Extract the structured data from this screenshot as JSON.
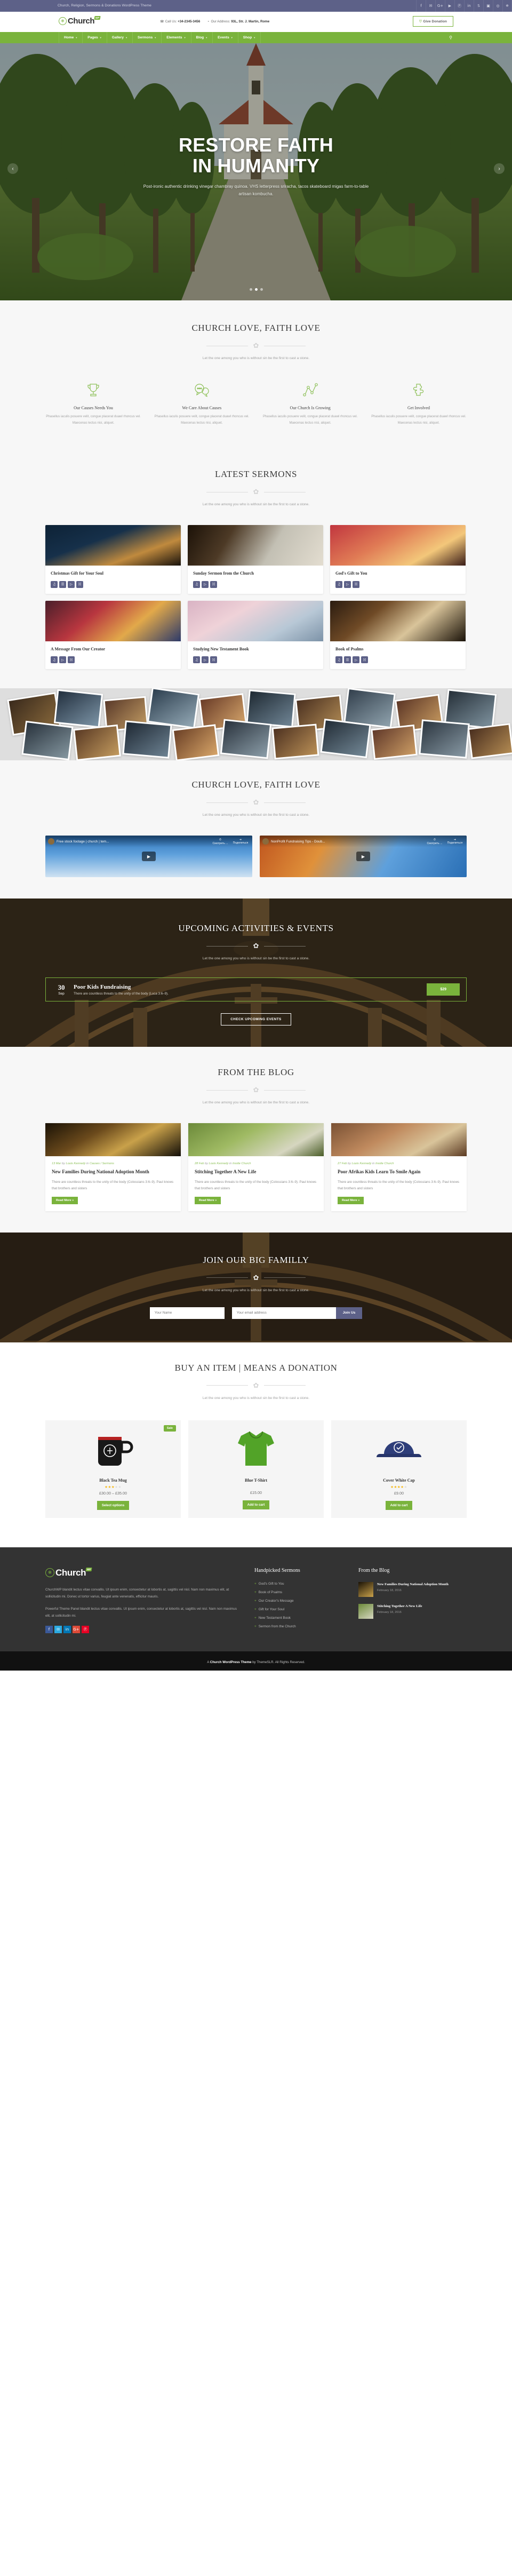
{
  "topbar": {
    "tagline": "Church, Religion, Sermons & Donations WordPress Theme",
    "social": [
      {
        "name": "facebook-icon",
        "glyph": "f"
      },
      {
        "name": "twitter-icon",
        "glyph": "✉"
      },
      {
        "name": "google-plus-icon",
        "glyph": "G+"
      },
      {
        "name": "youtube-icon",
        "glyph": "▶"
      },
      {
        "name": "pinterest-icon",
        "glyph": "Ⓟ"
      },
      {
        "name": "linkedin-icon",
        "glyph": "in"
      },
      {
        "name": "skype-icon",
        "glyph": "S"
      },
      {
        "name": "instagram-icon",
        "glyph": "▣"
      },
      {
        "name": "dribbble-icon",
        "glyph": "◎"
      },
      {
        "name": "flickr-icon",
        "glyph": "✵"
      }
    ]
  },
  "header": {
    "logo_text": "Church",
    "logo_badge": "WP",
    "call_label": "Call Us:",
    "call_value": "+34-2345-3456",
    "address_label": "Our Address:",
    "address_value": "93L, Str. J. Martin, Rome",
    "donate_label": "Give Donation"
  },
  "nav": {
    "items": [
      {
        "label": "Home"
      },
      {
        "label": "Pages"
      },
      {
        "label": "Gallery"
      },
      {
        "label": "Sermons"
      },
      {
        "label": "Elements"
      },
      {
        "label": "Blog"
      },
      {
        "label": "Events"
      },
      {
        "label": "Shop"
      }
    ],
    "search_icon": "search-icon"
  },
  "hero": {
    "line1": "RESTORE FAITH",
    "line2": "IN HUMANITY",
    "subtitle": "Post-ironic authentic drinking vinegar chambray quinoa. VHS letterpress sriracha, tacos skateboard migas farm-to-table artisan kombucha.",
    "prev": "‹",
    "next": "›",
    "slide_count": 3,
    "active_slide": 2
  },
  "features_section": {
    "title": "CHURCH LOVE, FAITH LOVE",
    "subtitle": "Let the one among you who is without sin be the first to cast a stone.",
    "items": [
      {
        "icon": "trophy-icon",
        "title": "Our Causes Needs You",
        "text": "Phasellus iaculis posuere velit, congue placerat duawl rhoncus vel. Maecenas lectus nisi, aliquet."
      },
      {
        "icon": "chat-bubbles-icon",
        "title": "We Care About Causes",
        "text": "Phasellus iaculis posuere velit, congue placerat duawl rhoncus vel. Maecenas lectus nisi, aliquet."
      },
      {
        "icon": "growth-chart-icon",
        "title": "Our Church Is Growing",
        "text": "Phasellus iaculis posuere velit, congue placerat duawl rhoncus vel. Maecenas lectus nisi, aliquet."
      },
      {
        "icon": "puzzle-piece-icon",
        "title": "Get Involved",
        "text": "Phasellus iaculis posuere velit, congue placerat duawl rhoncus vel. Maecenas lectus nisi, aliquet."
      }
    ]
  },
  "sermons_section": {
    "title": "LATEST SERMONS",
    "subtitle": "Let the one among you who is without sin be the first to cast a stone.",
    "cards": [
      {
        "title": "Christmas Gift for Your Soul",
        "icons": [
          "audio-icon",
          "doc-icon",
          "video-icon",
          "bible-icon"
        ]
      },
      {
        "title": "Sunday Sermon from the Church",
        "icons": [
          "audio-icon",
          "video-icon",
          "bible-icon"
        ]
      },
      {
        "title": "God's Gift to You",
        "icons": [
          "audio-icon",
          "video-icon",
          "bible-icon"
        ]
      },
      {
        "title": "A Message From Our Creator",
        "icons": [
          "audio-icon",
          "video-icon",
          "bible-icon"
        ]
      },
      {
        "title": "Studying New Testament Book",
        "icons": [
          "audio-icon",
          "video-icon",
          "bible-icon"
        ]
      },
      {
        "title": "Book of Psalms",
        "icons": [
          "audio-icon",
          "doc-icon",
          "video-icon",
          "bible-icon"
        ]
      }
    ]
  },
  "videos_section": {
    "title": "CHURCH LOVE, FAITH LOVE",
    "subtitle": "Let the one among you who is without sin be the first to cast a stone.",
    "videos": [
      {
        "title": "Free stock footage | church | tem...",
        "watch": "Смотреть ...",
        "share": "Поделиться"
      },
      {
        "title": "NonProfit Fundraising Tips - Doub...",
        "watch": "Смотреть ...",
        "share": "Поделиться"
      }
    ]
  },
  "events_section": {
    "title": "UPCOMING ACTIVITIES & EVENTS",
    "subtitle": "Let the one among you who is without sin be the first to cast a stone.",
    "event": {
      "day": "30",
      "month": "Sep",
      "title": "Poor Kids Fundraising",
      "text": "There are countless threats to the unity of the body (Luca 3:6–9).",
      "price": "$29"
    },
    "button": "CHECK UPCOMING EVENTS"
  },
  "blog_section": {
    "title": "FROM THE BLOG",
    "subtitle": "Let the one among you who is without sin be the first to cast a stone.",
    "posts": [
      {
        "date": "13 Mar",
        "by": "by",
        "author": "Louis Kennedy",
        "in": "in",
        "cats": "Causes / Sermons",
        "title": "New Families During National Adoption Month",
        "text": "There are countless threats to the unity of the body (Colossians 3:6–9). Paul knows that brothers and sisters",
        "button": "Read More »"
      },
      {
        "date": "28 Feb",
        "by": "by",
        "author": "Louis Kennedy",
        "in": "in",
        "cats": "Inside Church",
        "title": "Stitching Together A New Life",
        "text": "There are countless threats to the unity of the body (Colossians 3:6–9). Paul knows that brothers and sisters",
        "button": "Read More »"
      },
      {
        "date": "27 Feb",
        "by": "by",
        "author": "Louis Kennedy",
        "in": "in",
        "cats": "Inside Church",
        "title": "Poor Afrikas Kids Learn To Smile Again",
        "text": "There are countless threats to the unity of the body (Colossians 3:6–9). Paul knows that brothers and sisters",
        "button": "Read More »"
      }
    ]
  },
  "newsletter_section": {
    "title": "JOIN OUR BIG FAMILLY",
    "subtitle": "Let the one among you who is without sin be the first to cast a stone.",
    "name_placeholder": "Your Name",
    "email_placeholder": "Your email address",
    "submit_label": "Join Us"
  },
  "shop_section": {
    "title": "BUY AN ITEM | MEANS A DONATION",
    "subtitle": "Let the one among you who is without sin be the first to cast a stone.",
    "products": [
      {
        "name": "Black Tea Mug",
        "price": "£30.00 – £35.00",
        "stars": 3,
        "button": "Select options",
        "badge": "Sale"
      },
      {
        "name": "Blue T-Shirt",
        "price": "£15.00",
        "stars": 0,
        "button": "Add to cart",
        "badge": ""
      },
      {
        "name": "Cover White Cap",
        "price": "£9.00",
        "stars": 4,
        "button": "Add to cart",
        "badge": ""
      }
    ]
  },
  "footer": {
    "logo_text": "Church",
    "logo_badge": "WP",
    "about1": "ChurchWP blandit lectus vitae convallis. Ut ipsum enim, consectetur at lobortis at, sagittis vel nisl. Nam non maximus elit, at sollicitudin mi. Donec ut tortor varius, feugiat ante venenatis, efficitur mauris.",
    "about2": "Powerful Theme Panel blandit lectus vitae convallis. Ut ipsum enim, consectetur at lobortis at, sagittis vel nisl. Nam non maximus elit, at sollicitudin mi.",
    "social": [
      {
        "name": "facebook-icon",
        "glyph": "f",
        "color": "#3b5998"
      },
      {
        "name": "twitter-icon",
        "glyph": "✉",
        "color": "#2caae1"
      },
      {
        "name": "linkedin-icon",
        "glyph": "in",
        "color": "#0077b5"
      },
      {
        "name": "google-plus-icon",
        "glyph": "G+",
        "color": "#dd4b39"
      },
      {
        "name": "pinterest-icon",
        "glyph": "Ⓟ",
        "color": "#e60023"
      }
    ],
    "sermons_head": "Handpicked Sermons",
    "sermons": [
      {
        "label": "God's Gift to You"
      },
      {
        "label": "Book of Psalms"
      },
      {
        "label": "Our Creator's Message"
      },
      {
        "label": "Gift for Your Soul"
      },
      {
        "label": "New Testament Book"
      },
      {
        "label": "Sermon from the Church"
      }
    ],
    "blog_head": "From the Blog",
    "posts": [
      {
        "title": "New Families During National Adoption Month",
        "date": "February 18, 2016"
      },
      {
        "title": "Stitching Together A New Life",
        "date": "February 18, 2016"
      }
    ],
    "copyright_pre": "A ",
    "copyright_brand": "Church WordPress Theme",
    "copyright_post": " by ThemeSLR. All Rights Reserved."
  },
  "colors": {
    "green": "#7ab33c",
    "purple": "#5d6188",
    "dark": "#333333"
  }
}
